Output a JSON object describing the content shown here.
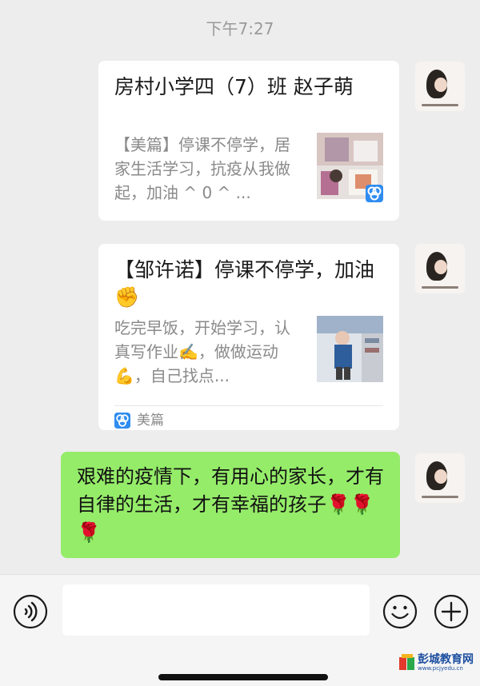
{
  "timestamp": "下午7:27",
  "messages": [
    {
      "title": "房村小学四（7）班   赵子萌",
      "description": "【美篇】停课不停学，居家生活学习，抗疫从我做起，加油 ^ 0 ^ ...",
      "thumb_icon": "meipian-badge-icon"
    },
    {
      "title": "【邹许诺】停课不停学，加油✊",
      "description": "吃完早饭，开始学习，认真写作业✍️，做做运动💪，自己找点...",
      "source": "美篇"
    },
    {
      "text": "艰难的疫情下，有用心的家长，才有自律的生活，才有幸福的孩子🌹🌹🌹"
    }
  ],
  "input_bar": {
    "voice_icon": "voice-icon",
    "emoji_icon": "emoji-icon",
    "add_icon": "plus-icon"
  },
  "watermark": {
    "name": "彭城教育网",
    "url": "www.pcjyedu.cn"
  },
  "colors": {
    "background": "#ededed",
    "bubble_green": "#95ec69",
    "meipian_blue": "#2f8cf0"
  }
}
